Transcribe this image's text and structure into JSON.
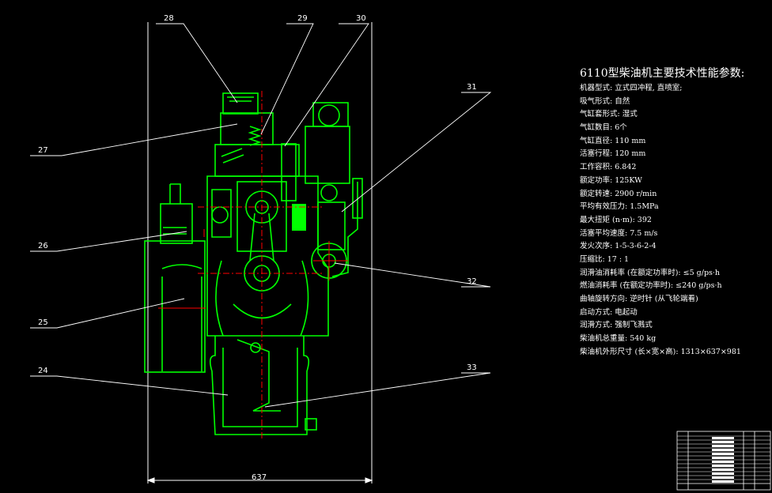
{
  "drawing": {
    "dimension_width": "637",
    "callouts": [
      "28",
      "29",
      "30",
      "27",
      "31",
      "26",
      "32",
      "25",
      "24",
      "33"
    ],
    "line_color": "#ffffff",
    "part_color": "#00ff00",
    "accent_color": "#ff0000"
  },
  "specs": {
    "title": "6110型柴油机主要技术性能参数:",
    "items": [
      "机器型式: 立式四冲程, 直喷室;",
      "吸气形式: 自然",
      "气缸套形式: 湿式",
      "气缸数目: 6个",
      "气缸直径: 110 mm",
      "活塞行程: 120 mm",
      "工作容积: 6.842",
      "额定功率: 125KW",
      "额定转速: 2900 r/min",
      "平均有效压力: 1.5MPa",
      "最大扭矩 (n·m): 392",
      "活塞平均速度: 7.5 m/s",
      "发火次序: 1-5-3-6-2-4",
      "压缩比: 17 : 1",
      "润滑油消耗率 (在额定功率时): ≤5 g/ps·h",
      "燃油消耗率 (在额定功率时): ≤240 g/ps·h",
      "曲轴旋转方向: 逆时针 (从飞轮端看)",
      "启动方式: 电起动",
      "润滑方式: 强制飞溅式",
      "柴油机总重量: 540 kg",
      "柴油机外形尺寸 (长×宽×高): 1313×637×981"
    ]
  }
}
